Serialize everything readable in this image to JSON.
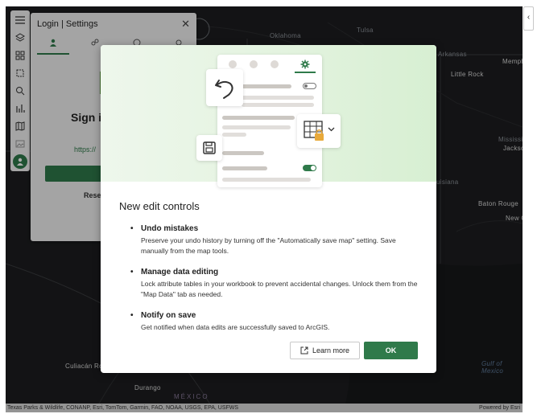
{
  "map": {
    "labels": {
      "oklahoma": "Oklahoma",
      "tulsa": "Tulsa",
      "arkansas": "Arkansas",
      "memphis": "Memphis",
      "little_rock": "Little Rock",
      "mississippi": "Mississippi",
      "jackson": "Jackson",
      "louisiana": "uisiana",
      "baton_rouge": "Baton Rouge",
      "new_orleans": "New Orle",
      "gulf": "Gulf of\nMexico",
      "culiacan": "Culiacán Ro",
      "durango": "Durango",
      "mexico": "MÉXICO"
    },
    "attribution": "Texas Parks & Wildlife, CONANP, Esri, TomTom, Garmin, FAO, NOAA, USGS, EPA, USFWS",
    "powered_by": "Powered by Esri"
  },
  "right_tab": {
    "glyph": "‹"
  },
  "toolbar": {
    "icons": [
      "menu-icon",
      "layers-icon",
      "basemap-icon",
      "select-icon",
      "search-icon",
      "chart-icon",
      "map-icon",
      "image-icon",
      "user-icon"
    ]
  },
  "login_panel": {
    "title": "Login | Settings",
    "close_glyph": "✕",
    "sign_in_partial": "Sign i",
    "url_partial": "https://",
    "reset_partial": "Rese"
  },
  "dialog": {
    "title": "New edit controls",
    "items": [
      {
        "heading": "Undo mistakes",
        "body": "Preserve your undo history by turning off the \"Automatically save map\" setting. Save manually from the map tools."
      },
      {
        "heading": "Manage data editing",
        "body": "Lock attribute tables in your workbook to prevent accidental changes. Unlock them from the \"Map Data\" tab as needed."
      },
      {
        "heading": "Notify on save",
        "body": "Get notified when data edits are successfully saved to ArcGIS."
      }
    ],
    "learn_more_label": "Learn more",
    "ok_label": "OK",
    "bullet": "•"
  },
  "colors": {
    "accent": "#2f7a4a",
    "map_bg": "#1b1c1e"
  }
}
